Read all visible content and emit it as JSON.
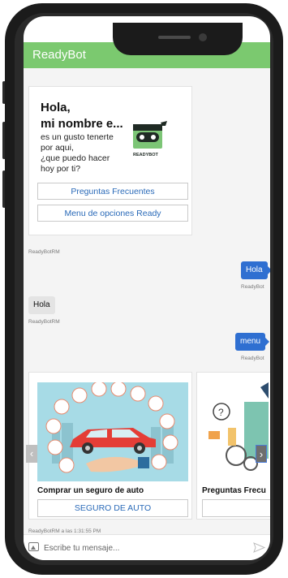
{
  "header": {
    "title": "ReadyBot"
  },
  "welcome": {
    "title_line1": "Hola,",
    "title_line2": "mi nombre e...",
    "text_lines": [
      "es un gusto tenerte",
      "por aqui,",
      "¿que puedo hacer",
      "hoy por ti?"
    ],
    "logo_text": "READYBOT",
    "buttons": [
      "Preguntas Frecuentes",
      "Menu de opciones Ready"
    ],
    "sender": "ReadyBotRM"
  },
  "messages": [
    {
      "from": "user",
      "text": "Hola",
      "sender": "ReadyBot"
    },
    {
      "from": "bot",
      "text": "Hola",
      "sender": "ReadyBotRM"
    },
    {
      "from": "user",
      "text": "menu",
      "sender": "ReadyBot"
    }
  ],
  "carousel": {
    "cards": [
      {
        "title": "Comprar un seguro de auto",
        "button": "SEGURO DE AUTO"
      },
      {
        "title": "Preguntas Frecu",
        "button": ""
      }
    ],
    "timestamp": "ReadyBotRM a las 1:31:55 PM",
    "prev_icon": "chevron-left-icon",
    "next_icon": "chevron-right-icon"
  },
  "input": {
    "placeholder": "Escribe tu mensaje...",
    "value": ""
  },
  "colors": {
    "header": "#7bc96f",
    "user_bubble": "#2f6fd1",
    "link": "#2a6ab8"
  }
}
